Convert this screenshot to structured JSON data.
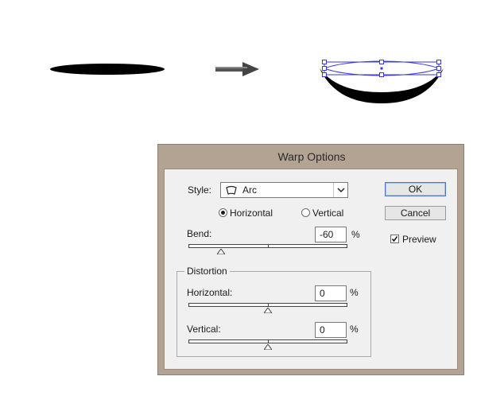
{
  "dialog": {
    "title": "Warp Options",
    "style": {
      "label": "Style:",
      "value": "Arc",
      "icon": "arc-warp-icon"
    },
    "orientation": {
      "options": [
        "Horizontal",
        "Vertical"
      ],
      "selected": "Horizontal"
    },
    "bend": {
      "label": "Bend:",
      "value": "-60",
      "unit": "%",
      "slider_fraction": 0.2
    },
    "distortion": {
      "legend": "Distortion",
      "horizontal": {
        "label": "Horizontal:",
        "value": "0",
        "unit": "%",
        "slider_fraction": 0.5
      },
      "vertical": {
        "label": "Vertical:",
        "value": "0",
        "unit": "%",
        "slider_fraction": 0.5
      }
    },
    "buttons": {
      "ok": "OK",
      "cancel": "Cancel"
    },
    "preview": {
      "label": "Preview",
      "checked": true
    }
  },
  "colors": {
    "dialog_frame": "#b3a393",
    "dialog_body": "#f0f0f0",
    "selection_blue": "#3a3ad6",
    "ok_focus_border": "#4a78c8"
  }
}
